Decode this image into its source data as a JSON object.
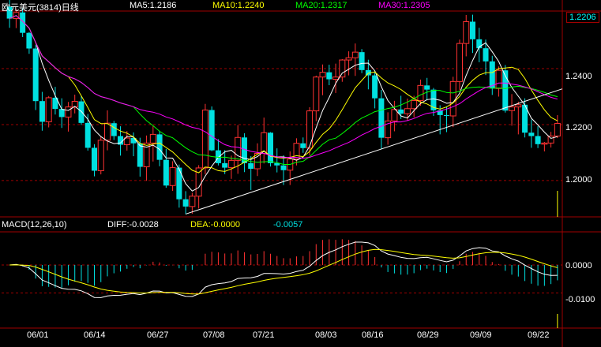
{
  "header": {
    "title": "欧元美元(3814)日线",
    "ma5": "MA5:1.2186",
    "ma10": "MA10:1.2240",
    "ma20": "MA20:1.2317",
    "ma30": "MA30:1.2305"
  },
  "price_axis": {
    "current": "1.2206",
    "ticks": [
      "1.2400",
      "1.2200",
      "1.2000"
    ]
  },
  "macd_header": {
    "label": "MACD(12,26,10)",
    "diff": "DIFF:-0.0028",
    "dea": "DEA:-0.0000",
    "macd": "-0.0057"
  },
  "macd_axis": {
    "ticks": [
      "0.0000",
      "-0.0100"
    ]
  },
  "dates": [
    "06/01",
    "06/14",
    "06/27",
    "07/08",
    "07/21",
    "08/03",
    "08/16",
    "08/29",
    "09/09",
    "09/22"
  ],
  "colors": {
    "up": "#ff3232",
    "down": "#00e0e0",
    "ma5": "#ffffff",
    "ma10": "#ffff00",
    "ma20": "#00ff00",
    "ma30": "#ff00ff",
    "grid": "#a00000",
    "frame": "#a00000"
  },
  "chart_data": {
    "type": "candlestick",
    "xlabels": [
      "06/01",
      "06/14",
      "06/27",
      "07/08",
      "07/21",
      "08/03",
      "08/16",
      "08/29",
      "09/09",
      "09/22"
    ],
    "ylim": [
      1.187,
      1.2606
    ],
    "yticks": [
      1.24,
      1.22,
      1.2
    ],
    "candles": [
      [
        1.2622,
        1.2647,
        1.2546,
        1.2579
      ],
      [
        1.2579,
        1.2614,
        1.2545,
        1.2601
      ],
      [
        1.2601,
        1.2617,
        1.2513,
        1.2528
      ],
      [
        1.2528,
        1.2531,
        1.2453,
        1.2472
      ],
      [
        1.2472,
        1.2484,
        1.2252,
        1.2284
      ],
      [
        1.2284,
        1.2317,
        1.2178,
        1.221
      ],
      [
        1.221,
        1.2302,
        1.219,
        1.2296
      ],
      [
        1.2296,
        1.2335,
        1.2236,
        1.2256
      ],
      [
        1.2256,
        1.2294,
        1.2188,
        1.2227
      ],
      [
        1.2227,
        1.2281,
        1.2175,
        1.2263
      ],
      [
        1.2263,
        1.2307,
        1.224,
        1.2283
      ],
      [
        1.2283,
        1.2302,
        1.2199,
        1.2206
      ],
      [
        1.2206,
        1.2238,
        1.2107,
        1.2117
      ],
      [
        1.2117,
        1.213,
        1.2015,
        1.2035
      ],
      [
        1.2035,
        1.2156,
        1.2022,
        1.2144
      ],
      [
        1.2144,
        1.2251,
        1.2108,
        1.2205
      ],
      [
        1.2205,
        1.2213,
        1.2145,
        1.2159
      ],
      [
        1.2159,
        1.2194,
        1.2089,
        1.2128
      ],
      [
        1.2128,
        1.2177,
        1.2107,
        1.2152
      ],
      [
        1.2152,
        1.2172,
        1.2087,
        1.2133
      ],
      [
        1.2133,
        1.2153,
        1.2014,
        1.2049
      ],
      [
        1.2049,
        1.2161,
        1.1999,
        1.2134
      ],
      [
        1.2134,
        1.2194,
        1.2068,
        1.2165
      ],
      [
        1.2165,
        1.2177,
        1.2051,
        1.2074
      ],
      [
        1.2074,
        1.2113,
        1.1974,
        1.1982
      ],
      [
        1.1982,
        1.2069,
        1.1963,
        1.2046
      ],
      [
        1.2046,
        1.2057,
        1.1903,
        1.1933
      ],
      [
        1.1933,
        1.1962,
        1.188,
        1.1907
      ],
      [
        1.1907,
        1.1956,
        1.1881,
        1.1944
      ],
      [
        1.1944,
        1.2055,
        1.19,
        1.2045
      ],
      [
        1.2045,
        1.2274,
        1.2022,
        1.2252
      ],
      [
        1.2252,
        1.2265,
        1.2105,
        1.2108
      ],
      [
        1.2108,
        1.2148,
        1.2054,
        1.2062
      ],
      [
        1.2062,
        1.2109,
        1.2023,
        1.2046
      ],
      [
        1.2046,
        1.2089,
        1.2006,
        1.2072
      ],
      [
        1.2072,
        1.2198,
        1.2024,
        1.2154
      ],
      [
        1.2154,
        1.2169,
        1.203,
        1.2062
      ],
      [
        1.2062,
        1.2087,
        1.1966,
        1.2042
      ],
      [
        1.2042,
        1.2133,
        1.2016,
        1.2097
      ],
      [
        1.2097,
        1.2225,
        1.2061,
        1.2171
      ],
      [
        1.2171,
        1.2173,
        1.205,
        1.2062
      ],
      [
        1.2062,
        1.2115,
        1.2029,
        1.2054
      ],
      [
        1.2054,
        1.209,
        1.1984,
        1.2037
      ],
      [
        1.2037,
        1.2104,
        1.1984,
        1.2077
      ],
      [
        1.2077,
        1.2151,
        1.2054,
        1.2133
      ],
      [
        1.2133,
        1.2154,
        1.2099,
        1.2116
      ],
      [
        1.2116,
        1.2262,
        1.209,
        1.2249
      ],
      [
        1.2249,
        1.2375,
        1.2212,
        1.237
      ],
      [
        1.237,
        1.2415,
        1.2305,
        1.2387
      ],
      [
        1.2387,
        1.2414,
        1.2341,
        1.2362
      ],
      [
        1.2362,
        1.2418,
        1.2313,
        1.237
      ],
      [
        1.237,
        1.2434,
        1.2353,
        1.2431
      ],
      [
        1.2431,
        1.2462,
        1.2376,
        1.2439
      ],
      [
        1.2439,
        1.249,
        1.2374,
        1.2459
      ],
      [
        1.2459,
        1.247,
        1.2384,
        1.2395
      ],
      [
        1.2395,
        1.2432,
        1.2326,
        1.2376
      ],
      [
        1.2376,
        1.2391,
        1.2258,
        1.2294
      ],
      [
        1.2294,
        1.2324,
        1.2112,
        1.2153
      ],
      [
        1.2153,
        1.2244,
        1.2128,
        1.2213
      ],
      [
        1.2213,
        1.2285,
        1.2176,
        1.2254
      ],
      [
        1.2254,
        1.2303,
        1.222,
        1.2239
      ],
      [
        1.2239,
        1.2293,
        1.2215,
        1.2257
      ],
      [
        1.2257,
        1.2303,
        1.2226,
        1.2286
      ],
      [
        1.2286,
        1.2361,
        1.2267,
        1.234
      ],
      [
        1.234,
        1.2367,
        1.2287,
        1.2325
      ],
      [
        1.2325,
        1.2331,
        1.2231,
        1.2251
      ],
      [
        1.2251,
        1.2269,
        1.2165,
        1.2234
      ],
      [
        1.2234,
        1.2265,
        1.2173,
        1.2231
      ],
      [
        1.2231,
        1.2371,
        1.2191,
        1.2354
      ],
      [
        1.2354,
        1.2504,
        1.2323,
        1.249
      ],
      [
        1.249,
        1.2592,
        1.2444,
        1.2568
      ],
      [
        1.2568,
        1.2593,
        1.2456,
        1.2505
      ],
      [
        1.2505,
        1.2546,
        1.2423,
        1.2473
      ],
      [
        1.2473,
        1.2504,
        1.2377,
        1.2426
      ],
      [
        1.2426,
        1.2446,
        1.2306,
        1.2329
      ],
      [
        1.2329,
        1.2408,
        1.23,
        1.2394
      ],
      [
        1.2394,
        1.2413,
        1.2243,
        1.225
      ],
      [
        1.225,
        1.2309,
        1.2196,
        1.2263
      ],
      [
        1.2263,
        1.2282,
        1.2165,
        1.2271
      ],
      [
        1.2271,
        1.2294,
        1.2154,
        1.2171
      ],
      [
        1.2171,
        1.2218,
        1.2117,
        1.2159
      ],
      [
        1.2159,
        1.2194,
        1.2116,
        1.213
      ],
      [
        1.213,
        1.2138,
        1.2104,
        1.2134
      ],
      [
        1.2134,
        1.2174,
        1.2118,
        1.2159
      ],
      [
        1.2159,
        1.2234,
        1.2152,
        1.2204
      ]
    ],
    "series": [
      {
        "name": "MA5"
      },
      {
        "name": "MA10"
      },
      {
        "name": "MA20"
      },
      {
        "name": "MA30"
      }
    ],
    "trendline": [
      [
        27,
        1.188
      ],
      [
        84,
        1.2322
      ]
    ],
    "macd": {
      "title": "MACD(12,26,10)",
      "ylim": [
        -0.0225,
        0.0118
      ],
      "yticks": [
        0.0,
        -0.01
      ]
    }
  }
}
